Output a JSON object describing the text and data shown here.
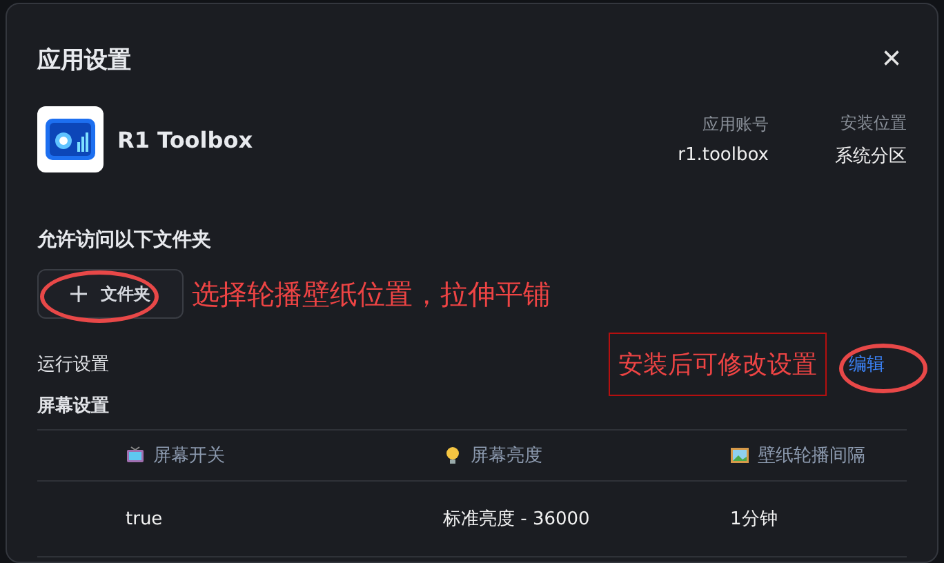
{
  "dialog": {
    "title": "应用设置",
    "close": "×"
  },
  "app": {
    "name": "R1 Toolbox",
    "meta": [
      {
        "label": "应用账号",
        "value": "r1.toolbox"
      },
      {
        "label": "安装位置",
        "value": "系统分区"
      }
    ]
  },
  "folders": {
    "heading": "允许访问以下文件夹",
    "button": "文件夹"
  },
  "run_settings": {
    "label": "运行设置",
    "action": "编辑"
  },
  "screen_settings": {
    "label": "屏幕设置",
    "columns": [
      {
        "label": "屏幕开关",
        "kind": "tv"
      },
      {
        "label": "屏幕亮度",
        "kind": "bulb"
      },
      {
        "label": "壁纸轮播间隔",
        "kind": "image"
      }
    ],
    "rows": [
      [
        "true",
        "标准亮度 - 36000",
        "1分钟"
      ]
    ]
  },
  "annotations": [
    {
      "kind": "note",
      "text": "选择轮播壁纸位置，拉伸平铺"
    },
    {
      "kind": "boxed",
      "text": "安装后可修改设置"
    }
  ]
}
